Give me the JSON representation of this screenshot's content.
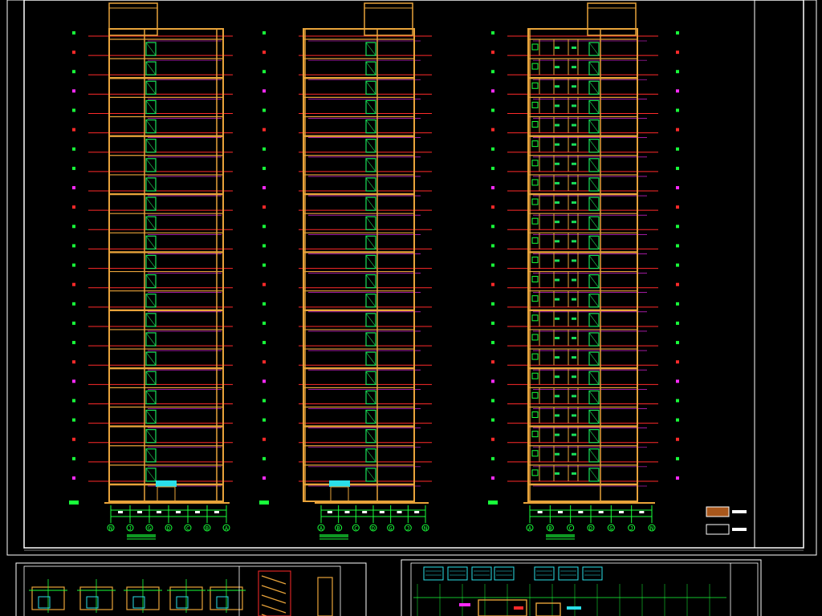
{
  "drawing": {
    "background": "#000000",
    "colors": {
      "frame": "#ffffff",
      "building": "#e8a33a",
      "floor_line": "#ff2a2a",
      "window": "#19e05a",
      "magenta": "#ff2aff",
      "cyan": "#2adfe8",
      "axis_green": "#18ff3a",
      "legend_fill": "#a8571c"
    },
    "floor_count": 24,
    "elevations": [
      {
        "id": "elevation-left",
        "axis_labels": [
          "N",
          "J",
          "G",
          "D",
          "C",
          "B",
          "A"
        ],
        "has_entrance": true
      },
      {
        "id": "elevation-mid",
        "axis_labels": [
          "A",
          "B",
          "C",
          "D",
          "G",
          "J",
          "N"
        ],
        "has_entrance": true
      },
      {
        "id": "elevation-right",
        "axis_labels": [
          "A",
          "B",
          "C",
          "D",
          "G",
          "J",
          "N"
        ],
        "has_entrance": false
      }
    ],
    "legend": [
      {
        "swatch": "#a8571c"
      },
      {
        "swatch": "#000000"
      }
    ],
    "detail_panels": [
      {
        "id": "stair-plans-panel"
      },
      {
        "id": "floor-plan-panel"
      }
    ]
  }
}
